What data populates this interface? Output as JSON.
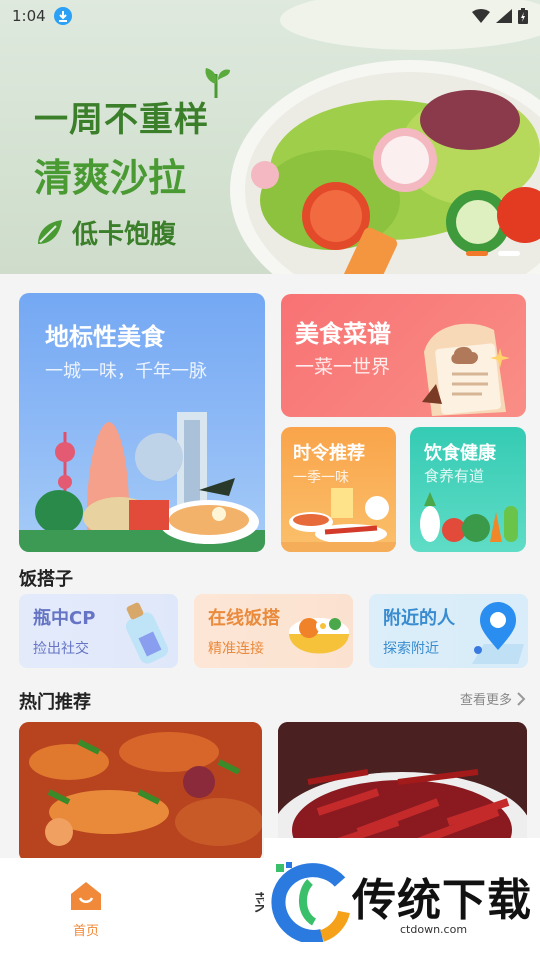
{
  "status_bar": {
    "time": "1:04"
  },
  "banner": {
    "line1": "一周不重样",
    "line2": "清爽沙拉",
    "line3": "低卡饱腹",
    "active_index": 1,
    "dot_colors": {
      "active": "#f07a2a",
      "inactive": "#ffffff"
    }
  },
  "features": {
    "landmark": {
      "title": "地标性美食",
      "subtitle": "一城一味，千年一脉"
    },
    "recipes": {
      "title": "美食菜谱",
      "subtitle": "一菜一世界"
    },
    "seasonal": {
      "title": "时令推荐",
      "subtitle": "一季一味"
    },
    "health": {
      "title": "饮食健康",
      "subtitle": "食养有道"
    }
  },
  "partner_section": {
    "title": "饭搭子",
    "items": [
      {
        "title": "瓶中CP",
        "subtitle": "捡出社交"
      },
      {
        "title": "在线饭搭",
        "subtitle": "精准连接"
      },
      {
        "title": "附近的人",
        "subtitle": "探索附近"
      }
    ]
  },
  "hot_section": {
    "title": "热门推荐",
    "more_label": "查看更多"
  },
  "bottom_nav": {
    "home_label": "首页",
    "partial_label": "菜"
  },
  "watermark": {
    "brand": "传统下载",
    "url": "ctdown.com"
  },
  "colors": {
    "accent": "#f08a3a",
    "blue_card": "#7aaef5",
    "red_card": "#f77b7b",
    "orange_card": "#f9a857",
    "teal_card": "#3fcfb6"
  }
}
